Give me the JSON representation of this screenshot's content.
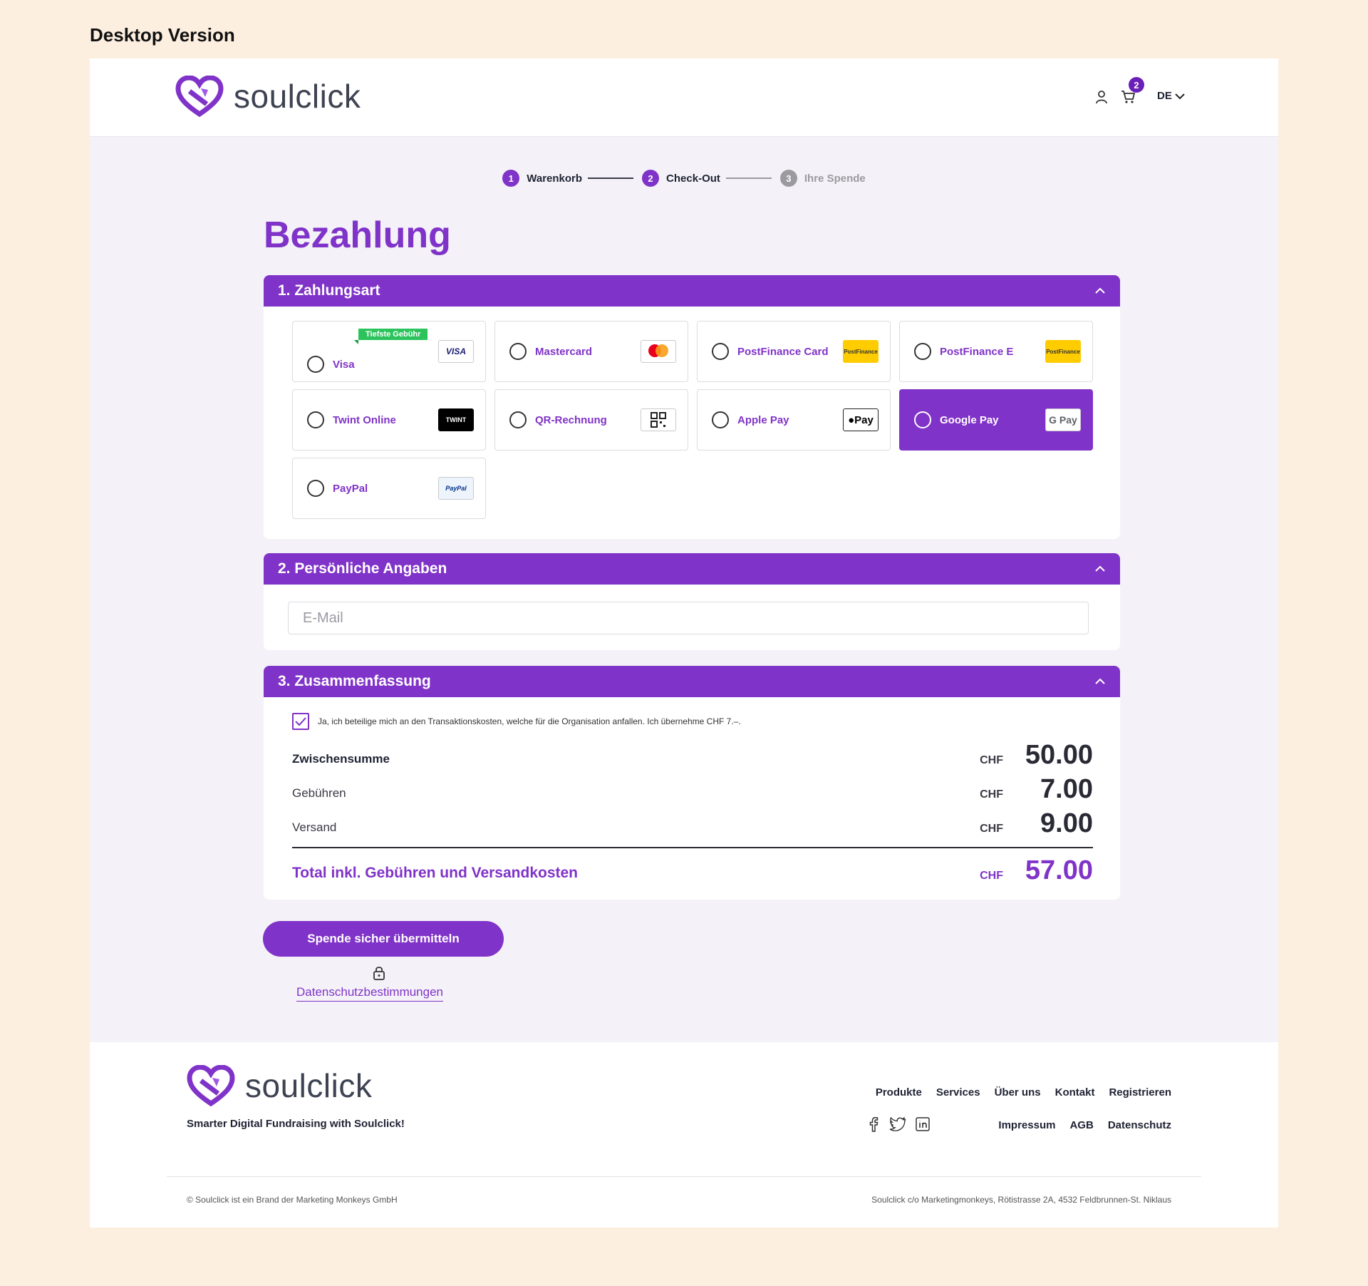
{
  "caption": "Desktop Version",
  "header": {
    "logo_text": "soulclick",
    "cart_count": "2",
    "language": "DE"
  },
  "steps": [
    {
      "num": "1",
      "label": "Warenkorb"
    },
    {
      "num": "2",
      "label": "Check-Out"
    },
    {
      "num": "3",
      "label": "Ihre Spende"
    }
  ],
  "page_title": "Bezahlung",
  "payment": {
    "title": "1. Zahlungsart",
    "lowest_fee_tag": "Tiefste Gebühr",
    "methods": [
      {
        "label": "Visa",
        "brand": "VISA"
      },
      {
        "label": "Mastercard",
        "brand": "mastercard"
      },
      {
        "label": "PostFinance Card",
        "brand": "PostFinance"
      },
      {
        "label": "PostFinance E",
        "brand": "PostFinance"
      },
      {
        "label": "Twint Online",
        "brand": "TWINT"
      },
      {
        "label": "QR-Rechnung",
        "brand": "QR"
      },
      {
        "label": "Apple Pay",
        "brand": "Pay"
      },
      {
        "label": "Google Pay",
        "brand": "G Pay"
      },
      {
        "label": "PayPal",
        "brand": "PayPal"
      }
    ],
    "selected": "Google Pay"
  },
  "personal": {
    "title": "2. Persönliche Angaben",
    "email_placeholder": "E-Mail",
    "email_value": ""
  },
  "summary": {
    "title": "3. Zusammenfassung",
    "consent_text": "Ja, ich beteilige mich an den Transaktionskosten, welche für die Organisation anfallen. Ich übernehme CHF 7.–.",
    "consent_checked": true,
    "currency": "CHF",
    "rows": [
      {
        "label": "Zwischensumme",
        "amount": "50.00"
      },
      {
        "label": "Gebühren",
        "amount": "7.00"
      },
      {
        "label": "Versand",
        "amount": "9.00"
      }
    ],
    "total_label": "Total inkl. Gebühren und Versandkosten",
    "total_amount": "57.00"
  },
  "submit_label": "Spende sicher übermitteln",
  "privacy_link": "Datenschutzbestimmungen",
  "footer": {
    "logo_text": "soulclick",
    "tagline": "Smarter Digital Fundraising with Soulclick!",
    "nav": [
      "Produkte",
      "Services",
      "Über uns",
      "Kontakt",
      "Registrieren"
    ],
    "legal": [
      "Impressum",
      "AGB",
      "Datenschutz"
    ],
    "copyright": "© Soulclick ist ein Brand der Marketing Monkeys GmbH",
    "address": "Soulclick c/o Marketingmonkeys, Rötistrasse 2A, 4532 Feldbrunnen-St. Niklaus"
  },
  "colors": {
    "accent": "#8033c8",
    "background": "#fdefe0",
    "success": "#2cc35c"
  }
}
